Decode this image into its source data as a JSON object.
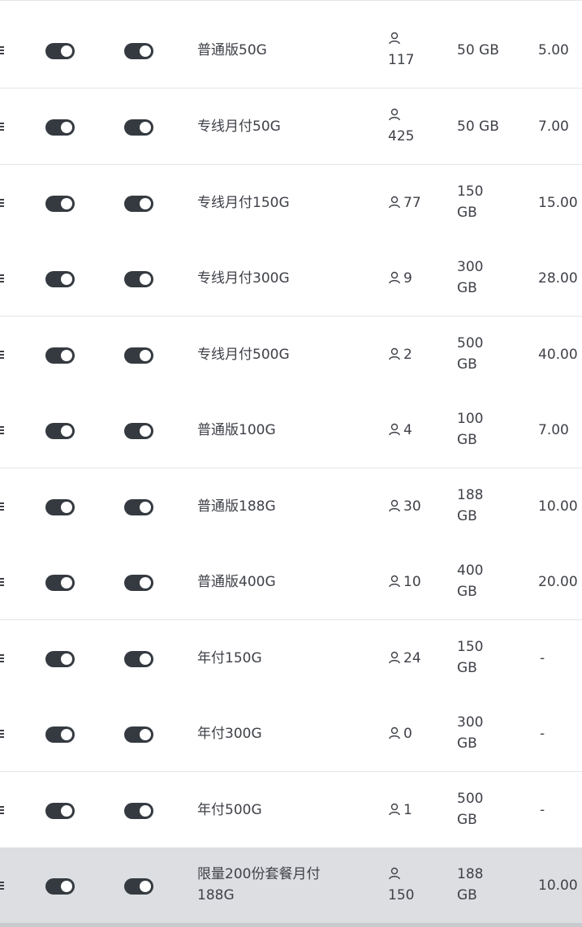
{
  "colors": {
    "toggle_track": "#343a40",
    "toggle_knob": "#ffffff",
    "text": "#3f4148",
    "row_selected_bg": "#dcdee1",
    "divider": "#e4e6e9"
  },
  "icons": {
    "drag": "drag-handle-icon",
    "user": "user-icon"
  },
  "rows": [
    {
      "name": "普通版50G",
      "users_icon_above": true,
      "users": "117",
      "traffic": "50 GB",
      "traffic_wrap": false,
      "price": "5.00",
      "toggle1_on": true,
      "toggle2_on": true
    },
    {
      "name": "专线月付50G",
      "users_icon_above": true,
      "users": "425",
      "traffic": "50 GB",
      "traffic_wrap": false,
      "price": "7.00",
      "toggle1_on": true,
      "toggle2_on": true
    },
    {
      "name": "专线月付150G",
      "users": "77",
      "traffic_l1": "150",
      "traffic_l2": "GB",
      "price": "15.00",
      "toggle1_on": true,
      "toggle2_on": true
    },
    {
      "name": "专线月付300G",
      "users": "9",
      "traffic_l1": "300",
      "traffic_l2": "GB",
      "price": "28.00",
      "toggle1_on": true,
      "toggle2_on": true
    },
    {
      "name": "专线月付500G",
      "users": "2",
      "traffic_l1": "500",
      "traffic_l2": "GB",
      "price": "40.00",
      "toggle1_on": true,
      "toggle2_on": true
    },
    {
      "name": "普通版100G",
      "users": "4",
      "traffic_l1": "100",
      "traffic_l2": "GB",
      "price": "7.00",
      "toggle1_on": true,
      "toggle2_on": true
    },
    {
      "name": "普通版188G",
      "users": "30",
      "traffic_l1": "188",
      "traffic_l2": "GB",
      "price": "10.00",
      "toggle1_on": true,
      "toggle2_on": true
    },
    {
      "name": "普通版400G",
      "users": "10",
      "traffic_l1": "400",
      "traffic_l2": "GB",
      "price": "20.00",
      "toggle1_on": true,
      "toggle2_on": true
    },
    {
      "name": "年付150G",
      "users": "24",
      "traffic_l1": "150",
      "traffic_l2": "GB",
      "price": "-",
      "toggle1_on": true,
      "toggle2_on": true
    },
    {
      "name": "年付300G",
      "users": "0",
      "traffic_l1": "300",
      "traffic_l2": "GB",
      "price": "-",
      "toggle1_on": true,
      "toggle2_on": true
    },
    {
      "name": "年付500G",
      "users": "1",
      "traffic_l1": "500",
      "traffic_l2": "GB",
      "price": "-",
      "toggle1_on": true,
      "toggle2_on": true
    },
    {
      "name_l1": "限量200份套餐月付",
      "name_l2": "188G",
      "users_icon_above": true,
      "users": "150",
      "traffic_l1": "188",
      "traffic_l2": "GB",
      "price": "10.00",
      "toggle1_on": true,
      "toggle2_on": true,
      "selected": true
    }
  ]
}
